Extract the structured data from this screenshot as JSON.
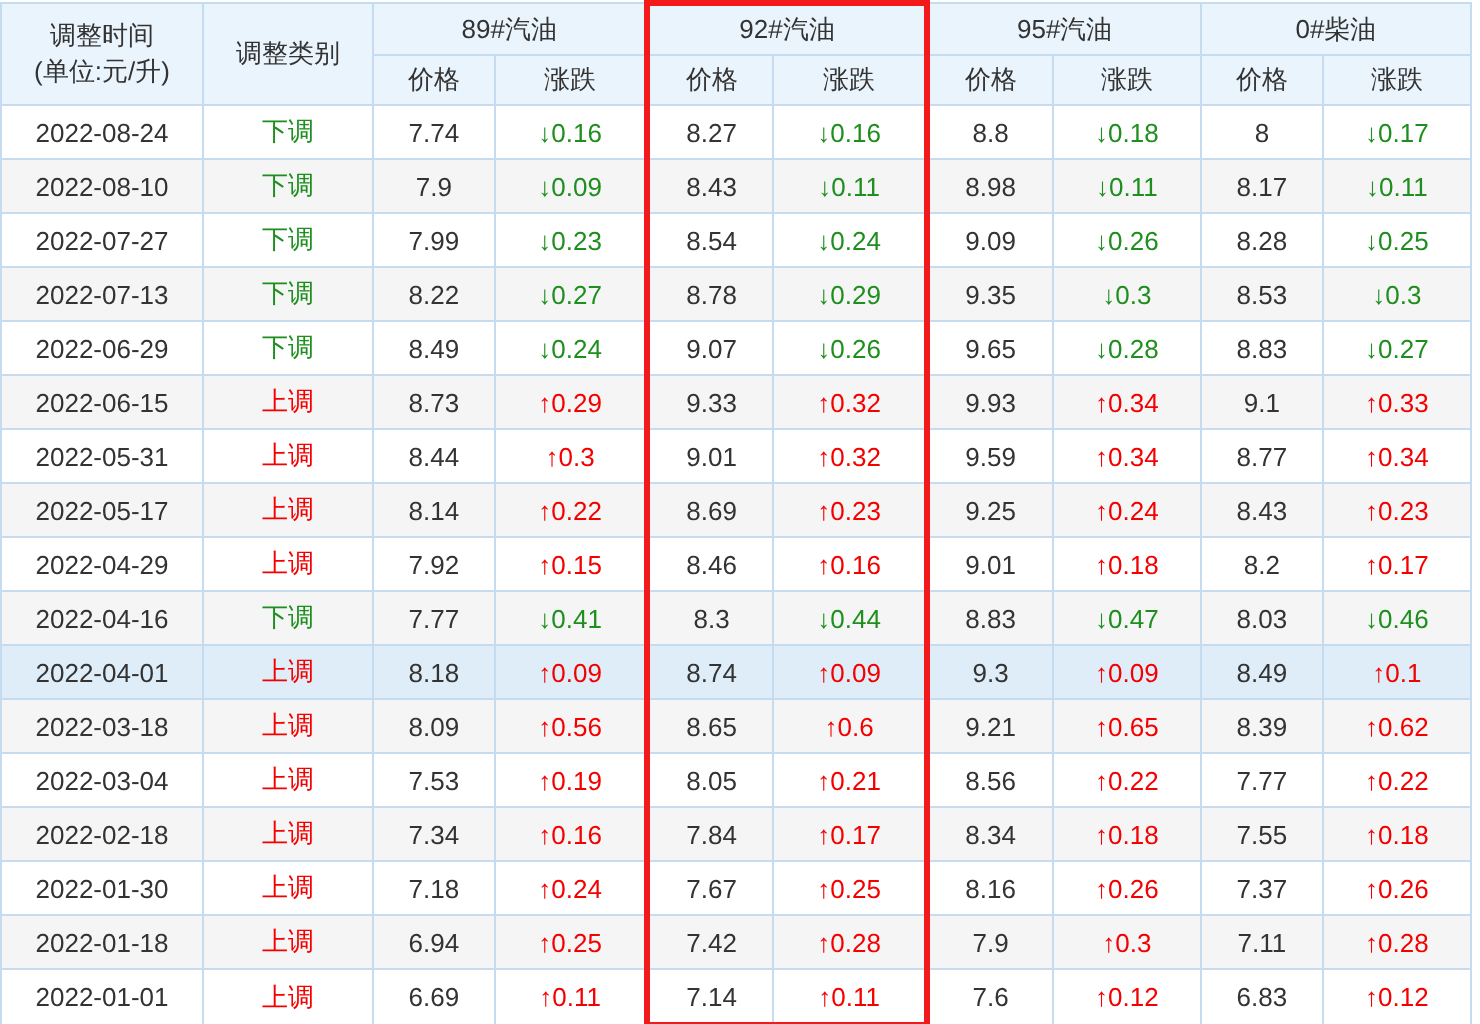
{
  "header": {
    "date": "调整时间",
    "unit": "(单位:元/升)",
    "type": "调整类别"
  },
  "fuels": [
    {
      "name": "89#汽油",
      "highlighted": false,
      "price_label": "价格",
      "change_label": "涨跌"
    },
    {
      "name": "92#汽油",
      "highlighted": true,
      "price_label": "价格",
      "change_label": "涨跌"
    },
    {
      "name": "95#汽油",
      "highlighted": false,
      "price_label": "价格",
      "change_label": "涨跌"
    },
    {
      "name": "0#柴油",
      "highlighted": false,
      "price_label": "价格",
      "change_label": "涨跌"
    }
  ],
  "rows": [
    {
      "date": "2022-08-24",
      "type": "下调",
      "kind": "down",
      "selected": false,
      "cells": [
        [
          "7.74",
          "↓0.16"
        ],
        [
          "8.27",
          "↓0.16"
        ],
        [
          "8.8",
          "↓0.18"
        ],
        [
          "8",
          "↓0.17"
        ]
      ]
    },
    {
      "date": "2022-08-10",
      "type": "下调",
      "kind": "down",
      "selected": false,
      "cells": [
        [
          "7.9",
          "↓0.09"
        ],
        [
          "8.43",
          "↓0.11"
        ],
        [
          "8.98",
          "↓0.11"
        ],
        [
          "8.17",
          "↓0.11"
        ]
      ]
    },
    {
      "date": "2022-07-27",
      "type": "下调",
      "kind": "down",
      "selected": false,
      "cells": [
        [
          "7.99",
          "↓0.23"
        ],
        [
          "8.54",
          "↓0.24"
        ],
        [
          "9.09",
          "↓0.26"
        ],
        [
          "8.28",
          "↓0.25"
        ]
      ]
    },
    {
      "date": "2022-07-13",
      "type": "下调",
      "kind": "down",
      "selected": false,
      "cells": [
        [
          "8.22",
          "↓0.27"
        ],
        [
          "8.78",
          "↓0.29"
        ],
        [
          "9.35",
          "↓0.3"
        ],
        [
          "8.53",
          "↓0.3"
        ]
      ]
    },
    {
      "date": "2022-06-29",
      "type": "下调",
      "kind": "down",
      "selected": false,
      "cells": [
        [
          "8.49",
          "↓0.24"
        ],
        [
          "9.07",
          "↓0.26"
        ],
        [
          "9.65",
          "↓0.28"
        ],
        [
          "8.83",
          "↓0.27"
        ]
      ]
    },
    {
      "date": "2022-06-15",
      "type": "上调",
      "kind": "up",
      "selected": false,
      "cells": [
        [
          "8.73",
          "↑0.29"
        ],
        [
          "9.33",
          "↑0.32"
        ],
        [
          "9.93",
          "↑0.34"
        ],
        [
          "9.1",
          "↑0.33"
        ]
      ]
    },
    {
      "date": "2022-05-31",
      "type": "上调",
      "kind": "up",
      "selected": false,
      "cells": [
        [
          "8.44",
          "↑0.3"
        ],
        [
          "9.01",
          "↑0.32"
        ],
        [
          "9.59",
          "↑0.34"
        ],
        [
          "8.77",
          "↑0.34"
        ]
      ]
    },
    {
      "date": "2022-05-17",
      "type": "上调",
      "kind": "up",
      "selected": false,
      "cells": [
        [
          "8.14",
          "↑0.22"
        ],
        [
          "8.69",
          "↑0.23"
        ],
        [
          "9.25",
          "↑0.24"
        ],
        [
          "8.43",
          "↑0.23"
        ]
      ]
    },
    {
      "date": "2022-04-29",
      "type": "上调",
      "kind": "up",
      "selected": false,
      "cells": [
        [
          "7.92",
          "↑0.15"
        ],
        [
          "8.46",
          "↑0.16"
        ],
        [
          "9.01",
          "↑0.18"
        ],
        [
          "8.2",
          "↑0.17"
        ]
      ]
    },
    {
      "date": "2022-04-16",
      "type": "下调",
      "kind": "down",
      "selected": false,
      "cells": [
        [
          "7.77",
          "↓0.41"
        ],
        [
          "8.3",
          "↓0.44"
        ],
        [
          "8.83",
          "↓0.47"
        ],
        [
          "8.03",
          "↓0.46"
        ]
      ]
    },
    {
      "date": "2022-04-01",
      "type": "上调",
      "kind": "up",
      "selected": true,
      "cells": [
        [
          "8.18",
          "↑0.09"
        ],
        [
          "8.74",
          "↑0.09"
        ],
        [
          "9.3",
          "↑0.09"
        ],
        [
          "8.49",
          "↑0.1"
        ]
      ]
    },
    {
      "date": "2022-03-18",
      "type": "上调",
      "kind": "up",
      "selected": false,
      "cells": [
        [
          "8.09",
          "↑0.56"
        ],
        [
          "8.65",
          "↑0.6"
        ],
        [
          "9.21",
          "↑0.65"
        ],
        [
          "8.39",
          "↑0.62"
        ]
      ]
    },
    {
      "date": "2022-03-04",
      "type": "上调",
      "kind": "up",
      "selected": false,
      "cells": [
        [
          "7.53",
          "↑0.19"
        ],
        [
          "8.05",
          "↑0.21"
        ],
        [
          "8.56",
          "↑0.22"
        ],
        [
          "7.77",
          "↑0.22"
        ]
      ]
    },
    {
      "date": "2022-02-18",
      "type": "上调",
      "kind": "up",
      "selected": false,
      "cells": [
        [
          "7.34",
          "↑0.16"
        ],
        [
          "7.84",
          "↑0.17"
        ],
        [
          "8.34",
          "↑0.18"
        ],
        [
          "7.55",
          "↑0.18"
        ]
      ]
    },
    {
      "date": "2022-01-30",
      "type": "上调",
      "kind": "up",
      "selected": false,
      "cells": [
        [
          "7.18",
          "↑0.24"
        ],
        [
          "7.67",
          "↑0.25"
        ],
        [
          "8.16",
          "↑0.26"
        ],
        [
          "7.37",
          "↑0.26"
        ]
      ]
    },
    {
      "date": "2022-01-18",
      "type": "上调",
      "kind": "up",
      "selected": false,
      "cells": [
        [
          "6.94",
          "↑0.25"
        ],
        [
          "7.42",
          "↑0.28"
        ],
        [
          "7.9",
          "↑0.3"
        ],
        [
          "7.11",
          "↑0.28"
        ]
      ]
    },
    {
      "date": "2022-01-01",
      "type": "上调",
      "kind": "up",
      "selected": false,
      "cells": [
        [
          "6.69",
          "↑0.11"
        ],
        [
          "7.14",
          "↑0.11"
        ],
        [
          "7.6",
          "↑0.12"
        ],
        [
          "6.83",
          "↑0.12"
        ]
      ]
    }
  ]
}
